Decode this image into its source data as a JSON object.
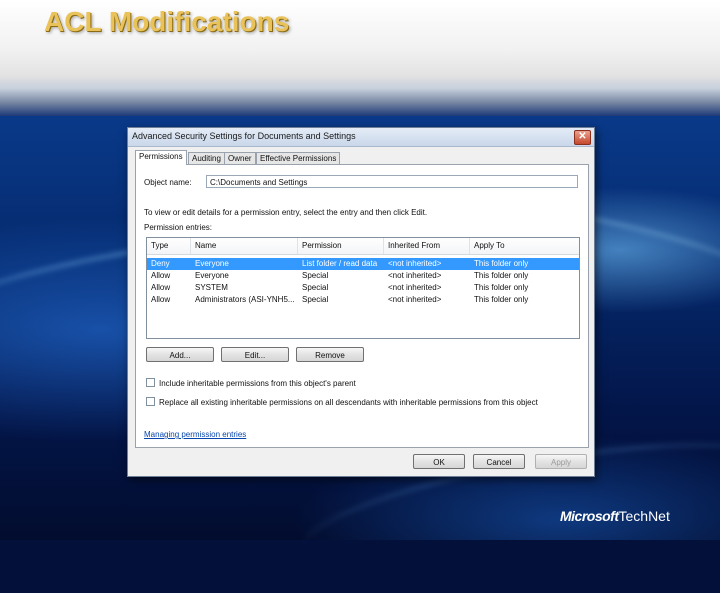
{
  "slide": {
    "title": "ACL Modifications"
  },
  "dialog": {
    "title": "Advanced Security Settings for Documents and Settings",
    "close_glyph": "✕",
    "tabs": [
      {
        "label": "Permissions"
      },
      {
        "label": "Auditing"
      },
      {
        "label": "Owner"
      },
      {
        "label": "Effective Permissions"
      }
    ],
    "active_tab": "Permissions",
    "object_name_label": "Object name:",
    "object_name_value": "C:\\Documents and Settings",
    "instructions": "To view or edit details for a permission entry, select the entry and then click Edit.",
    "entries_label": "Permission entries:",
    "columns": [
      "Type",
      "Name",
      "Permission",
      "Inherited From",
      "Apply To"
    ],
    "rows": [
      {
        "type": "Deny",
        "name": "Everyone",
        "permission": "List folder / read data",
        "inherited": "<not inherited>",
        "apply": "This folder only",
        "selected": true
      },
      {
        "type": "Allow",
        "name": "Everyone",
        "permission": "Special",
        "inherited": "<not inherited>",
        "apply": "This folder only",
        "selected": false
      },
      {
        "type": "Allow",
        "name": "SYSTEM",
        "permission": "Special",
        "inherited": "<not inherited>",
        "apply": "This folder only",
        "selected": false
      },
      {
        "type": "Allow",
        "name": "Administrators (ASI-YNH5...",
        "permission": "Special",
        "inherited": "<not inherited>",
        "apply": "This folder only",
        "selected": false
      }
    ],
    "buttons": {
      "add": "Add...",
      "edit": "Edit...",
      "remove": "Remove"
    },
    "checkbox_include": "Include inheritable permissions from this object's parent",
    "checkbox_replace": "Replace all existing inheritable permissions on all descendants with inheritable permissions from this object",
    "link_manage": "Managing permission entries",
    "footer": {
      "ok": "OK",
      "cancel": "Cancel",
      "apply": "Apply"
    }
  },
  "logo": {
    "brand": "Microsoft",
    "product": "TechNet"
  }
}
